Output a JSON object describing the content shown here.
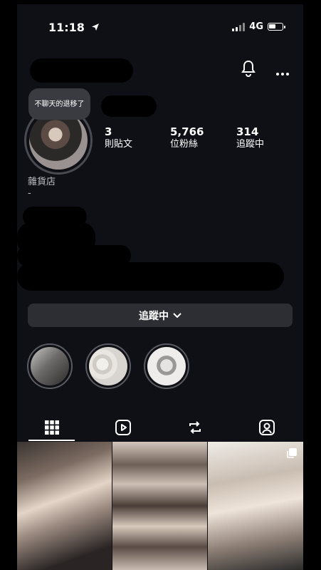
{
  "status": {
    "time": "11:18",
    "network": "4G"
  },
  "profile": {
    "note": "不聊天的退移了",
    "stats": [
      {
        "value": "3",
        "label": "則貼文"
      },
      {
        "value": "5,766",
        "label": "位粉絲"
      },
      {
        "value": "314",
        "label": "追蹤中"
      }
    ],
    "category": "雜貨店",
    "bio_line": "-"
  },
  "follow_button": {
    "label": "追蹤中"
  },
  "highlights": [
    "highlight-1",
    "highlight-2",
    "highlight-3"
  ],
  "tabs": [
    "grid-icon",
    "reels-icon",
    "reposts-icon",
    "tagged-icon"
  ],
  "colors": {
    "background": "#0f1015",
    "button": "#2d2e34",
    "text": "#ffffff",
    "muted": "#bdbdc2"
  }
}
